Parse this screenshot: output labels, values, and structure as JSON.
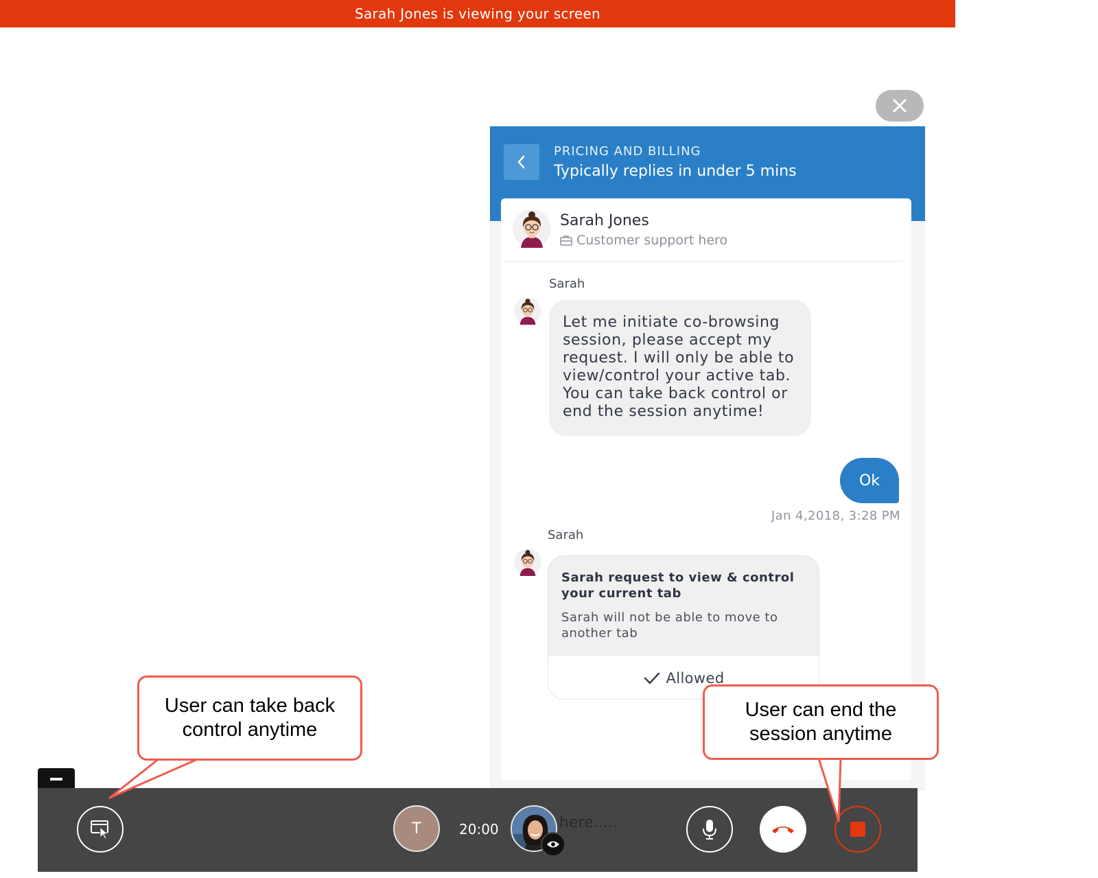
{
  "banner": {
    "text": "Sarah Jones is viewing your screen"
  },
  "widget": {
    "team_name": "PRICING AND BILLING",
    "reply_time": "Typically replies in under 5 mins",
    "agent": {
      "name": "Sarah Jones",
      "role": "Customer support hero"
    },
    "messages": [
      {
        "sender": "Sarah",
        "text": "Let me initiate co-browsing session, please accept my request. I will only be able to view/control your active tab. You can take back control or end the session anytime!"
      },
      {
        "sender": "user",
        "text": "Ok",
        "timestamp": "Jan 4,2018, 3:28 PM"
      },
      {
        "sender": "Sarah",
        "request_title": "Sarah request to view & control your current tab",
        "request_desc": "Sarah will not be able to move to another tab",
        "status": "Allowed"
      }
    ],
    "composer": {
      "placeholder_visible": "here....."
    }
  },
  "toolbar": {
    "user_initial": "T",
    "timer": "20:00",
    "icons": [
      "take-control-icon",
      "eye-icon",
      "microphone-icon",
      "hang-up-icon",
      "stop-icon",
      "paperclip-icon",
      "emoji-icon"
    ]
  },
  "callouts": {
    "left": "User can take back control anytime",
    "right": "User can end the session anytime"
  },
  "colors": {
    "banner": "#e2380d",
    "header": "#2a7fc7",
    "toolbar": "#454545",
    "callout_border": "#ef5b4e"
  }
}
